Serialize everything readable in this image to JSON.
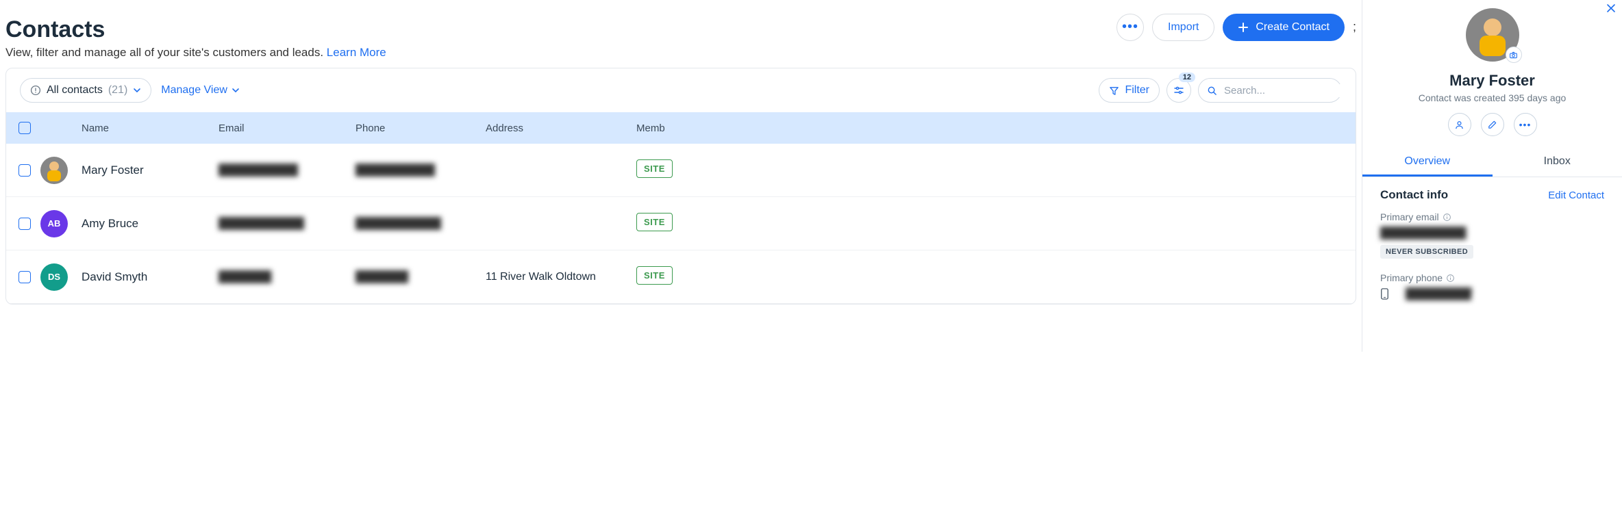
{
  "header": {
    "title": "Contacts",
    "subtitle_pre": "View, filter and manage all of your site's customers and leads. ",
    "learn_more": "Learn More",
    "import_label": "Import",
    "create_label": "Create Contact",
    "semic": ";"
  },
  "toolbar": {
    "all_contacts_label": "All contacts",
    "all_contacts_count": "(21)",
    "manage_view_label": "Manage View",
    "filter_label": "Filter",
    "settings_badge": "12",
    "search_placeholder": "Search..."
  },
  "table": {
    "headers": {
      "name": "Name",
      "email": "Email",
      "phone": "Phone",
      "address": "Address",
      "memb": "Memb"
    },
    "rows": [
      {
        "name": "Mary Foster",
        "email_redacted": "██▌ █▄▐▀▌███",
        "phone_redacted": "▐█▌█▌▐█▄  ▌ ▌",
        "address": "",
        "badge": "SITE",
        "avatar_type": "image",
        "avatar_class": "avatar-mary",
        "initials": ""
      },
      {
        "name": "Amy Bruce",
        "email_redacted": "▐█▐██▐█▄██▄ . ",
        "phone_redacted": "██▐▄▐█▐▌ ▌ █▌",
        "address": "",
        "badge": "SITE",
        "avatar_type": "initials",
        "avatar_class": "avatar-ab",
        "initials": "AB"
      },
      {
        "name": "David Smyth",
        "email_redacted": "▄▌ ░▟ ▐█",
        "phone_redacted": "▀▄▐▌ ▐█▀",
        "address": "11 River Walk Oldtown",
        "badge": "SITE",
        "avatar_type": "initials",
        "avatar_class": "avatar-ds",
        "initials": "DS"
      }
    ]
  },
  "panel": {
    "name": "Mary Foster",
    "created": "Contact was created 395 days ago",
    "tabs": {
      "overview": "Overview",
      "inbox": "Inbox"
    },
    "section_title": "Contact info",
    "edit_contact": "Edit Contact",
    "primary_email_label": "Primary email",
    "primary_email_value": "▐▄▟ ▐░▐█▌ █ █",
    "never_subscribed": "NEVER SUBSCRIBED",
    "primary_phone_label": "Primary phone",
    "primary_phone_value": "▐░▄  ██ ▐▌▀"
  }
}
